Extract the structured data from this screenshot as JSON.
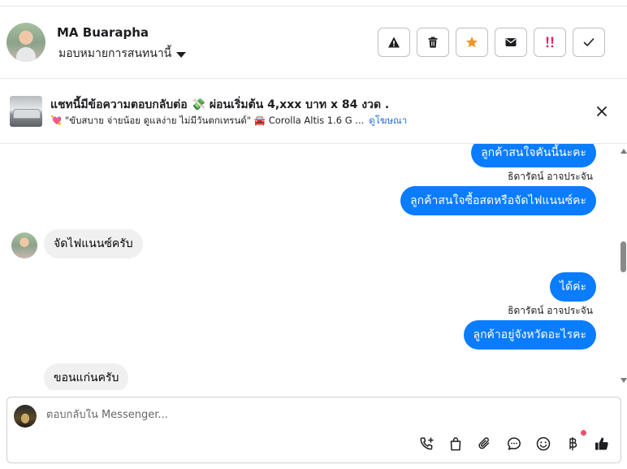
{
  "header": {
    "name": "MA Buarapha",
    "status": "มอบหมายการสนทนานี้",
    "actions": [
      {
        "icon": "warning-icon"
      },
      {
        "icon": "trash-icon"
      },
      {
        "icon": "star-icon",
        "color": "#f0952b"
      },
      {
        "icon": "envelope-icon"
      },
      {
        "icon": "double-exclamation-icon",
        "color": "#e0245e"
      },
      {
        "icon": "checkmark-icon"
      }
    ]
  },
  "ad": {
    "title": "แชทนี้มีข้อความตอบกลับต่อ 💸 ผ่อนเริ่มต้น 4,xxx บาท x 84 งวด .",
    "subtitle": "💘 \"ขับสบาย จ่ายน้อย ดูแลง่าย ไม่มีวันตกเทรนด์\" 🚘 Corolla Altis 1.6 G ...",
    "link": "ดูโฆษณา"
  },
  "messages": [
    {
      "direction": "out",
      "text": "ลูกค้าสนใจคันนี้นะคะ"
    },
    {
      "direction": "meta",
      "text": "ธิดารัตน์ อาจประจัน"
    },
    {
      "direction": "out",
      "text": "ลูกค้าสนใจซื้อสดหรือจัดไฟแนนซ์คะ"
    },
    {
      "direction": "in",
      "text": "จัดไฟแนนซ์ครับ"
    },
    {
      "direction": "out",
      "text": "ได้ค่ะ"
    },
    {
      "direction": "meta",
      "text": "ธิดารัตน์ อาจประจัน"
    },
    {
      "direction": "out",
      "text": "ลูกค้าอยู่จังหวัดอะไรคะ"
    },
    {
      "direction": "in",
      "text": "ขอนแก่นครับ"
    }
  ],
  "composer": {
    "placeholder": "ตอบกลับใน Messenger...",
    "tools": [
      "call-plus-icon",
      "shopping-bag-icon",
      "paperclip-icon",
      "chat-bubble-icon",
      "smiley-icon",
      "baht-icon",
      "thumbs-up-icon"
    ]
  },
  "colors": {
    "accent": "#0a7cff",
    "incoming_bubble": "#f0f0f0",
    "link": "#216fdb"
  }
}
